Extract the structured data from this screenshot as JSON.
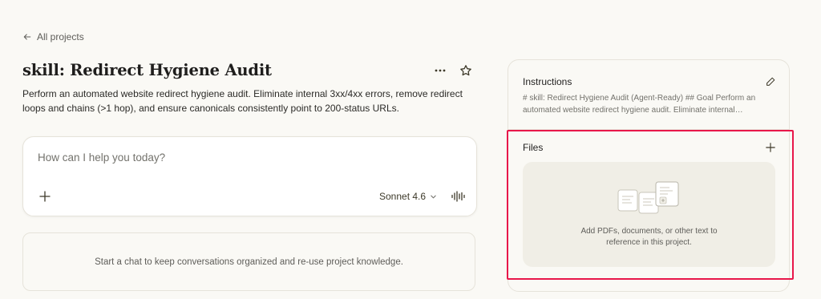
{
  "nav": {
    "back_label": "All projects"
  },
  "project": {
    "title": "skill: Redirect Hygiene Audit",
    "description": "Perform an automated website redirect hygiene audit. Eliminate internal 3xx/4xx errors, remove redirect loops and chains (>1 hop), and ensure canonicals consistently point to 200-status URLs.",
    "more_icon": "more-horizontal-icon",
    "star_icon": "star-icon"
  },
  "composer": {
    "placeholder": "How can I help you today?",
    "attach_icon": "plus-icon",
    "model": "Sonnet 4.6",
    "model_icon": "chevron-down-icon",
    "voice_icon": "waveform-icon"
  },
  "chats": {
    "empty_text": "Start a chat to keep conversations organized and re-use project knowledge."
  },
  "instructions": {
    "title": "Instructions",
    "preview": "# skill: Redirect Hygiene Audit (Agent-Ready) ## Goal Perform an automated website redirect hygiene audit. Eliminate internal…",
    "edit_icon": "pencil-icon"
  },
  "files": {
    "title": "Files",
    "add_icon": "plus-icon",
    "empty_line1": "Add PDFs, documents, or other text to",
    "empty_line2": "reference in this project."
  },
  "colors": {
    "background": "#faf9f5",
    "highlight": "#e8174a",
    "dropzone": "#f0eee6",
    "text": "#3d3929"
  }
}
